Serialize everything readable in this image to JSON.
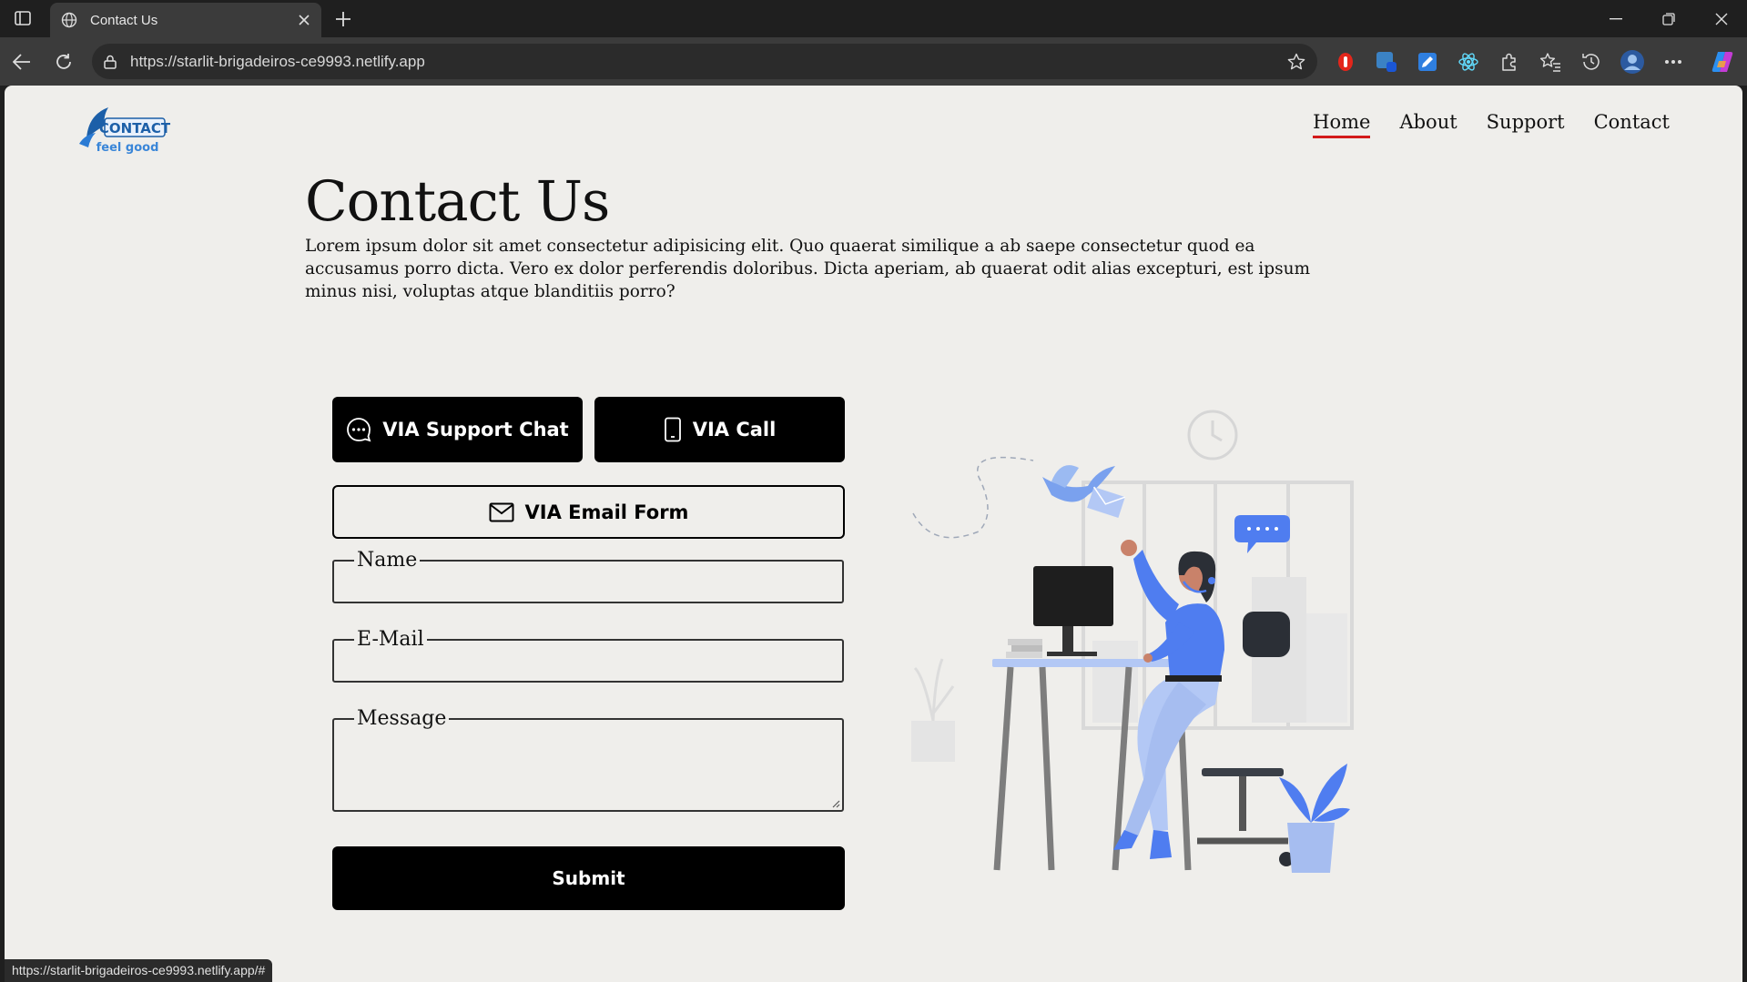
{
  "browser": {
    "tab_title": "Contact Us",
    "url": "https://starlit-brigadeiros-ce9993.netlify.app",
    "status_url": "https://starlit-brigadeiros-ce9993.netlify.app/#"
  },
  "site": {
    "logo_text": "CONTACT",
    "logo_tagline": "feel good",
    "nav": [
      {
        "label": "Home",
        "active": true
      },
      {
        "label": "About",
        "active": false
      },
      {
        "label": "Support",
        "active": false
      },
      {
        "label": "Contact",
        "active": false
      }
    ]
  },
  "main": {
    "title": "Contact Us",
    "intro": "Lorem ipsum dolor sit amet consectetur adipisicing elit. Quo quaerat similique a ab saepe consectetur quod ea accusamus porro dicta. Vero ex dolor perferendis doloribus. Dicta aperiam, ab quaerat odit alias excepturi, est ipsum minus nisi, voluptas atque blanditiis porro?",
    "support_chat_label": "VIA Support Chat",
    "call_label": "VIA Call",
    "email_form_label": "VIA Email Form",
    "form": {
      "name_label": "Name",
      "email_label": "E-Mail",
      "message_label": "Message",
      "submit_label": "Submit"
    }
  },
  "colors": {
    "page_bg": "#efeeeb",
    "accent_underline": "#d31a1a",
    "illustration_blue": "#4f7df0"
  }
}
